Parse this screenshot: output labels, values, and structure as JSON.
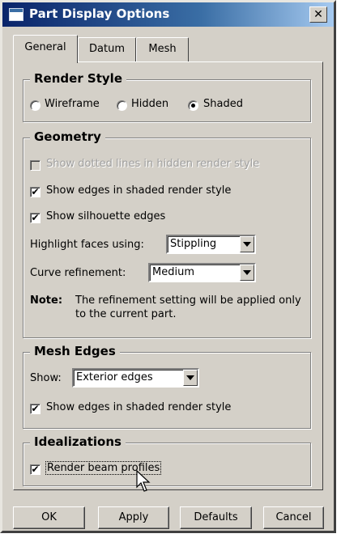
{
  "window": {
    "title": "Part Display Options",
    "close_glyph": "✕"
  },
  "tabs": [
    {
      "label": "General",
      "active": true
    },
    {
      "label": "Datum",
      "active": false
    },
    {
      "label": "Mesh",
      "active": false
    }
  ],
  "render_style": {
    "title": "Render Style",
    "options": [
      {
        "label": "Wireframe",
        "selected": false
      },
      {
        "label": "Hidden",
        "selected": false
      },
      {
        "label": "Shaded",
        "selected": true
      }
    ]
  },
  "geometry": {
    "title": "Geometry",
    "show_dotted_lines": {
      "label": "Show dotted lines in hidden render style",
      "checked": false,
      "enabled": false
    },
    "show_edges_shaded": {
      "label": "Show edges in shaded render style",
      "checked": true
    },
    "show_silhouette": {
      "label": "Show silhouette edges",
      "checked": true
    },
    "highlight_faces": {
      "label": "Highlight faces using:",
      "value": "Stippling"
    },
    "curve_refinement": {
      "label": "Curve refinement:",
      "value": "Medium"
    },
    "note": {
      "label": "Note:",
      "line1": "The refinement setting will be applied only",
      "line2": "to the current part."
    }
  },
  "mesh_edges": {
    "title": "Mesh Edges",
    "show_label": "Show:",
    "show_value": "Exterior edges",
    "show_edges_shaded": {
      "label": "Show edges in shaded render style",
      "checked": true
    }
  },
  "idealizations": {
    "title": "Idealizations",
    "render_beam_profiles": {
      "label": "Render beam profiles",
      "checked": true
    }
  },
  "buttons": {
    "ok": "OK",
    "apply": "Apply",
    "defaults": "Defaults",
    "cancel": "Cancel"
  },
  "check_glyph": "✔",
  "icons": {
    "title": "window-icon",
    "cursor": "arrow-cursor-icon"
  }
}
